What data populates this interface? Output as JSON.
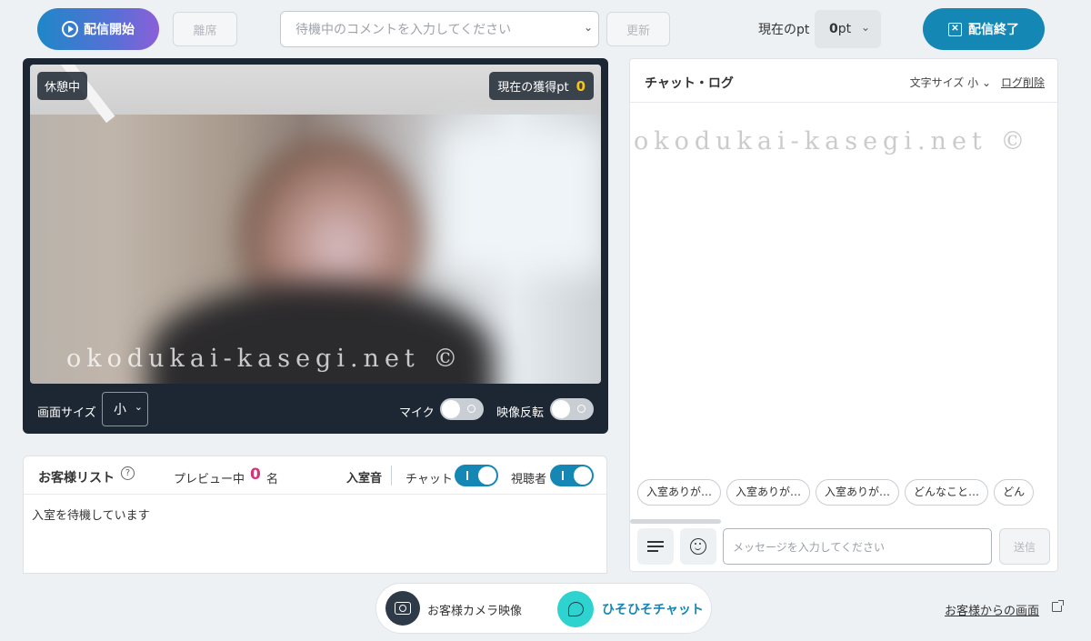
{
  "topbar": {
    "start_label": "配信開始",
    "leave_label": "離席",
    "comment_placeholder": "待機中のコメントを入力してください",
    "refresh_label": "更新",
    "current_pt_label": "現在のpt",
    "pt_value": "0",
    "pt_unit": "pt",
    "end_label": "配信終了"
  },
  "video": {
    "status_badge": "休憩中",
    "earned_label": "現在の獲得pt",
    "earned_value": "0",
    "watermark": "okodukai-kasegi.net ©"
  },
  "video_controls": {
    "screen_size_label": "画面サイズ",
    "screen_size_value": "小",
    "mic_label": "マイク",
    "mic_on": false,
    "mirror_label": "映像反転",
    "mirror_on": false
  },
  "customers": {
    "title": "お客様リスト",
    "help": "?",
    "preview_label": "プレビュー中",
    "preview_count": "0",
    "preview_unit": "名",
    "entry_sound_label": "入室音",
    "chat_label": "チャット",
    "chat_on": true,
    "viewer_label": "視聴者",
    "viewer_on": true,
    "empty_message": "入室を待機しています"
  },
  "chat": {
    "title": "チャット・ログ",
    "font_size_label": "文字サイズ 小",
    "log_delete_label": "ログ削除",
    "watermark": "okodukai-kasegi.net ©",
    "quick_replies": [
      "入室ありが…",
      "入室ありが…",
      "入室ありが…",
      "どんなこと…",
      "どん"
    ],
    "message_placeholder": "メッセージを入力してください",
    "send_label": "送信"
  },
  "bottom": {
    "camera_label": "お客様カメラ映像",
    "whisper_label": "ひそひそチャット",
    "customer_screen_label": "お客様からの画面"
  },
  "colors": {
    "accent_blue": "#1587b4",
    "pink_count": "#d6337a",
    "gold_pt": "#f5c518",
    "teal": "#2ed3cf",
    "panel_dark": "#1c2733"
  }
}
